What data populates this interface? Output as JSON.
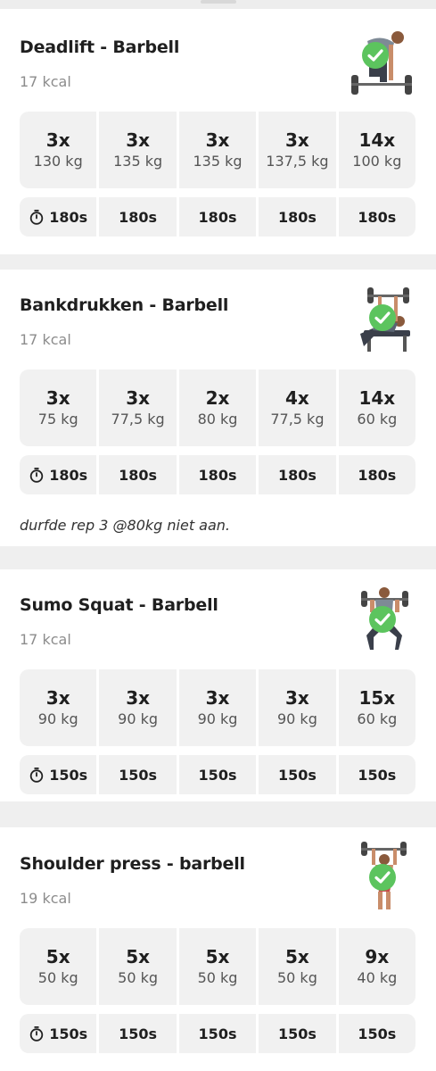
{
  "exercises": [
    {
      "title": "Deadlift - Barbell",
      "kcal": "17 kcal",
      "thumb": "deadlift-figure-icon",
      "sets": [
        {
          "reps": "3x",
          "weight": "130 kg"
        },
        {
          "reps": "3x",
          "weight": "135 kg"
        },
        {
          "reps": "3x",
          "weight": "135 kg"
        },
        {
          "reps": "3x",
          "weight": "137,5 kg"
        },
        {
          "reps": "14x",
          "weight": "100 kg"
        }
      ],
      "rest": [
        "180s",
        "180s",
        "180s",
        "180s",
        "180s"
      ],
      "note": ""
    },
    {
      "title": "Bankdrukken - Barbell",
      "kcal": "17 kcal",
      "thumb": "bench-press-figure-icon",
      "sets": [
        {
          "reps": "3x",
          "weight": "75 kg"
        },
        {
          "reps": "3x",
          "weight": "77,5 kg"
        },
        {
          "reps": "2x",
          "weight": "80 kg"
        },
        {
          "reps": "4x",
          "weight": "77,5 kg"
        },
        {
          "reps": "14x",
          "weight": "60 kg"
        }
      ],
      "rest": [
        "180s",
        "180s",
        "180s",
        "180s",
        "180s"
      ],
      "note": "durfde rep 3 @80kg niet aan."
    },
    {
      "title": "Sumo Squat - Barbell",
      "kcal": "17 kcal",
      "thumb": "sumo-squat-figure-icon",
      "sets": [
        {
          "reps": "3x",
          "weight": "90 kg"
        },
        {
          "reps": "3x",
          "weight": "90 kg"
        },
        {
          "reps": "3x",
          "weight": "90 kg"
        },
        {
          "reps": "3x",
          "weight": "90 kg"
        },
        {
          "reps": "15x",
          "weight": "60 kg"
        }
      ],
      "rest": [
        "150s",
        "150s",
        "150s",
        "150s",
        "150s"
      ],
      "note": ""
    },
    {
      "title": "Shoulder press - barbell",
      "kcal": "19 kcal",
      "thumb": "shoulder-press-figure-icon",
      "sets": [
        {
          "reps": "5x",
          "weight": "50 kg"
        },
        {
          "reps": "5x",
          "weight": "50 kg"
        },
        {
          "reps": "5x",
          "weight": "50 kg"
        },
        {
          "reps": "5x",
          "weight": "50 kg"
        },
        {
          "reps": "9x",
          "weight": "40 kg"
        }
      ],
      "rest": [
        "150s",
        "150s",
        "150s",
        "150s",
        "150s"
      ],
      "note": ""
    }
  ],
  "colors": {
    "check_green": "#5cc45e",
    "cell_bg": "#f1f1f1",
    "page_bg": "#efefef"
  },
  "icons": {
    "completed": "check-circle-icon",
    "rest_timer": "stopwatch-icon"
  }
}
